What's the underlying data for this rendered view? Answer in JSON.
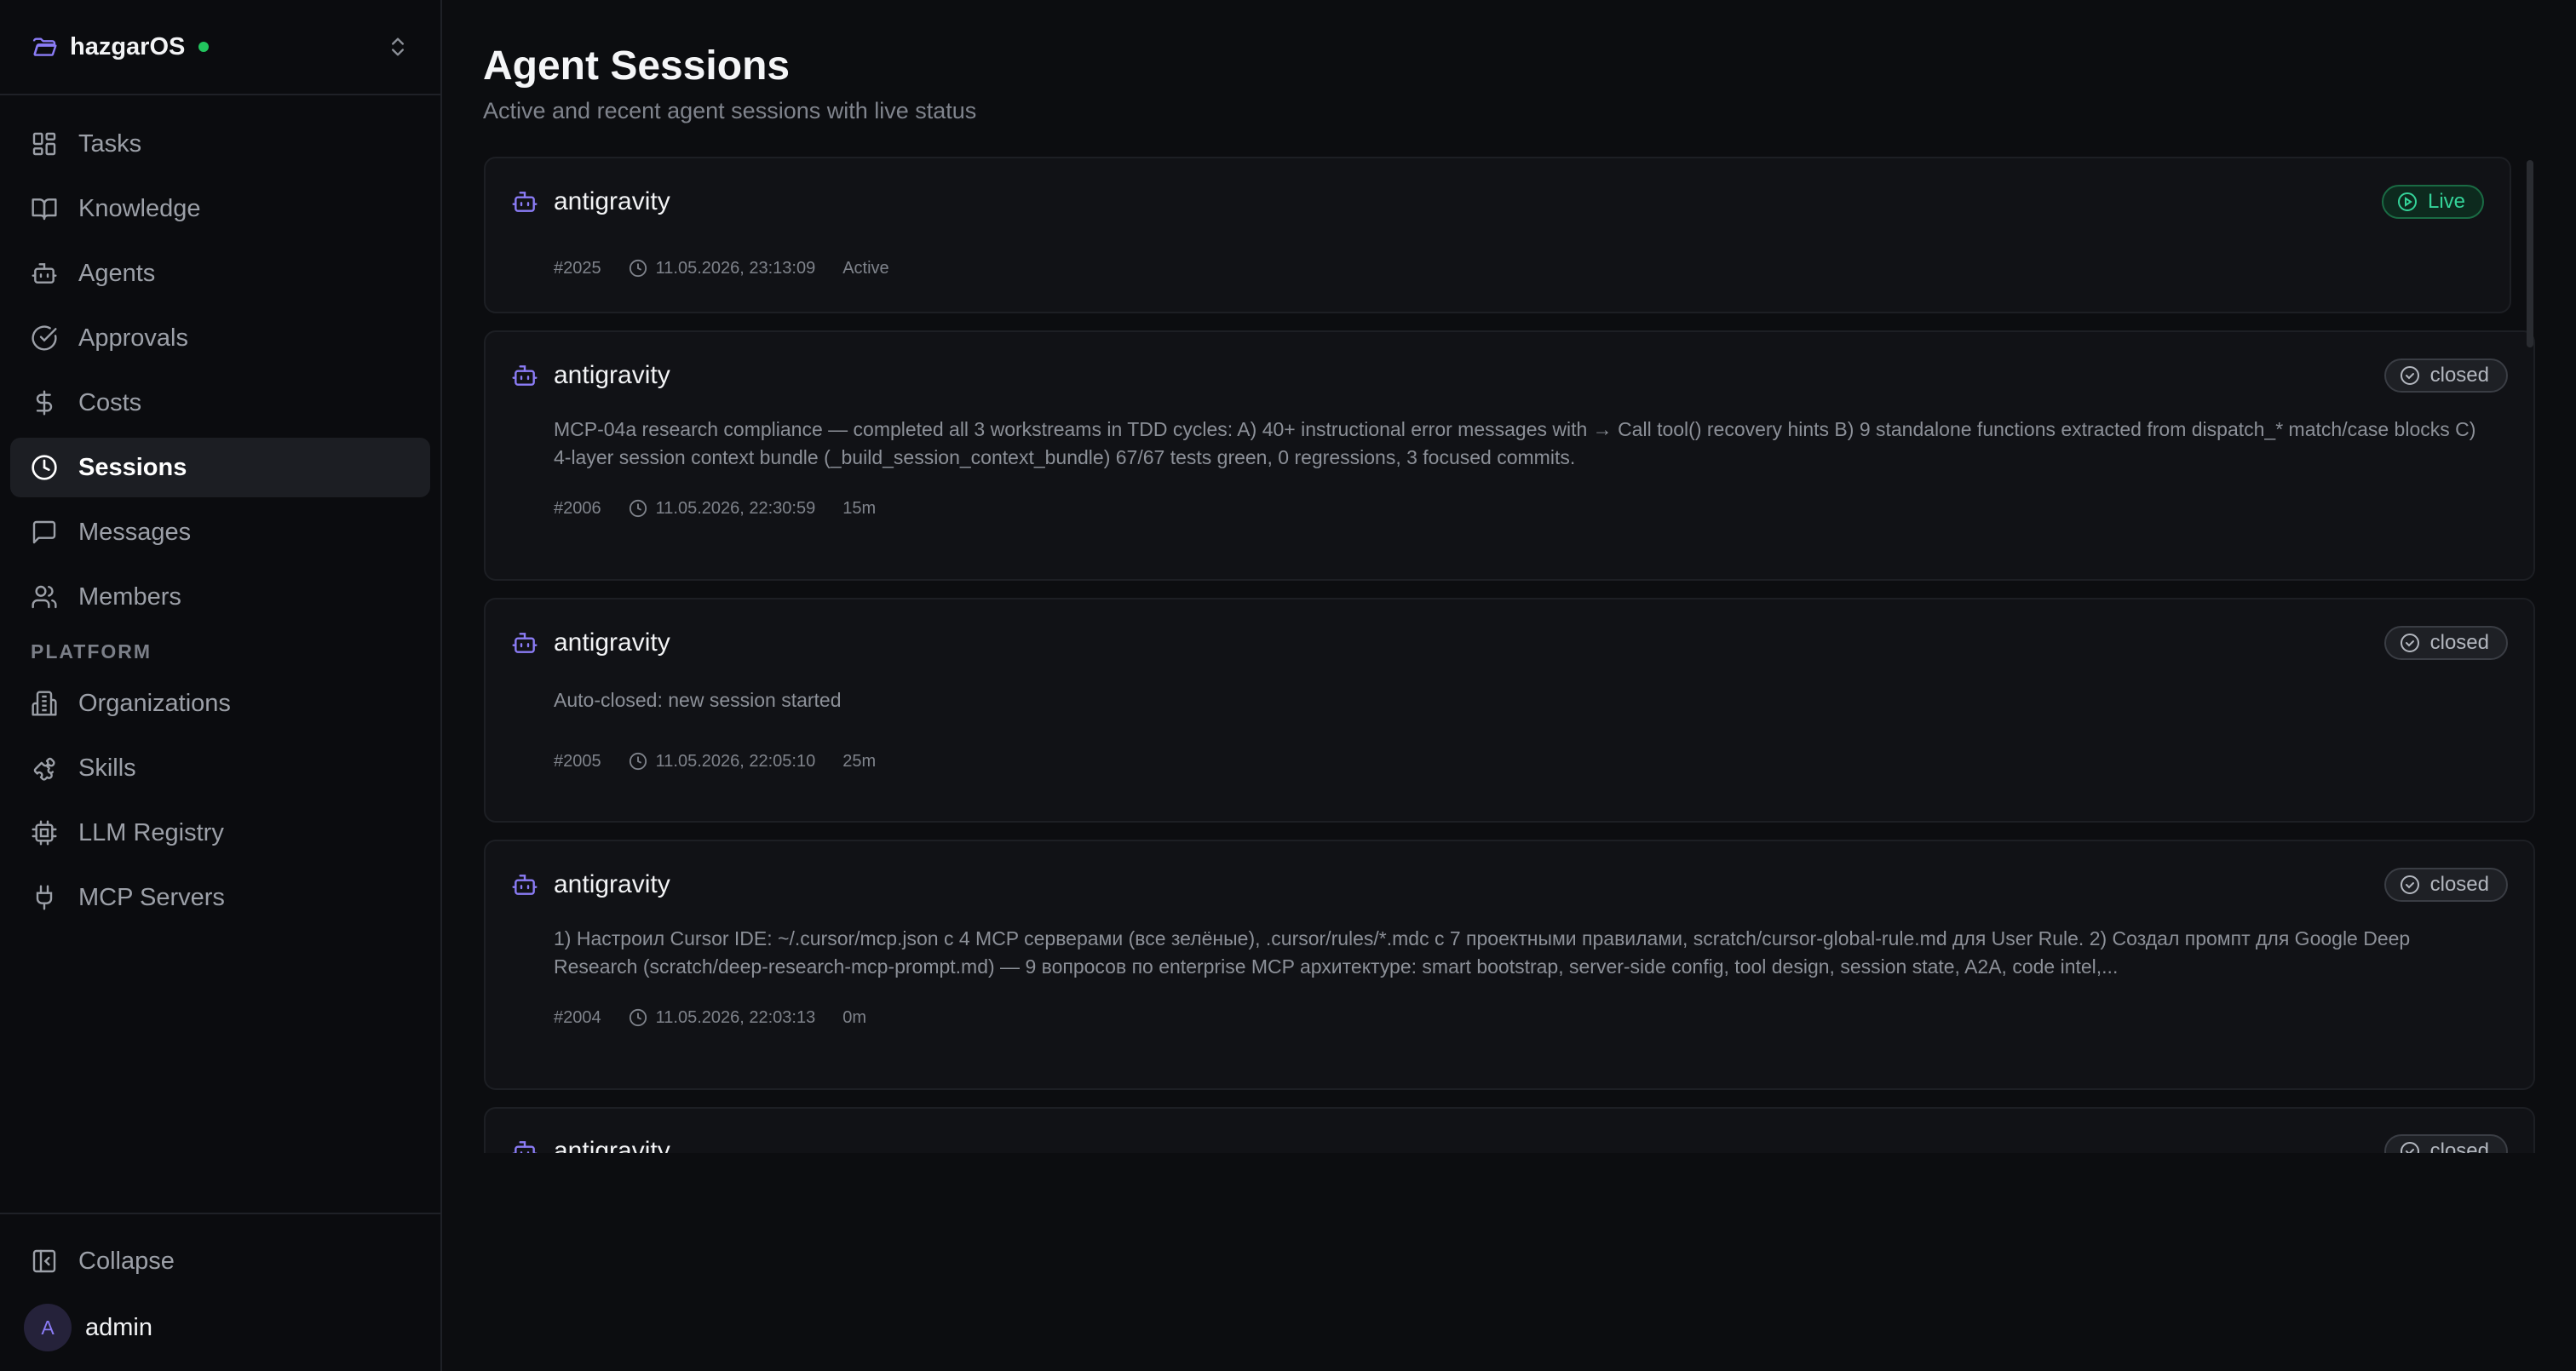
{
  "colors": {
    "accent": "#8b7cf6",
    "live_green": "#34d399",
    "status_dot": "#22c55e"
  },
  "org": {
    "name": "hazgarOS",
    "icon": "folder-icon",
    "switch_icon": "chevrons-up-down-icon"
  },
  "nav": {
    "items": [
      {
        "label": "Tasks",
        "icon": "grid-icon"
      },
      {
        "label": "Knowledge",
        "icon": "book-icon"
      },
      {
        "label": "Agents",
        "icon": "bot-icon"
      },
      {
        "label": "Approvals",
        "icon": "check-circle-icon"
      },
      {
        "label": "Costs",
        "icon": "dollar-icon"
      },
      {
        "label": "Sessions",
        "icon": "clock-icon"
      },
      {
        "label": "Messages",
        "icon": "message-icon"
      },
      {
        "label": "Members",
        "icon": "users-icon"
      }
    ],
    "platform_label": "PLATFORM",
    "platform_items": [
      {
        "label": "Organizations",
        "icon": "building-icon"
      },
      {
        "label": "Skills",
        "icon": "puzzle-icon"
      },
      {
        "label": "LLM Registry",
        "icon": "chip-icon"
      },
      {
        "label": "MCP Servers",
        "icon": "plug-icon"
      }
    ]
  },
  "sidebar_bottom": {
    "collapse_label": "Collapse",
    "avatar_letter": "A",
    "user_name": "admin"
  },
  "page": {
    "title": "Agent Sessions",
    "subtitle": "Active and recent agent sessions with live status"
  },
  "sessions": [
    {
      "agent": "antigravity",
      "status": "Live",
      "description": "",
      "id": "#2025",
      "timestamp": "11.05.2026, 23:13:09",
      "duration": "Active"
    },
    {
      "agent": "antigravity",
      "status": "closed",
      "description": "MCP-04a research compliance — completed all 3 workstreams in TDD cycles: A) 40+ instructional error messages with → Call tool() recovery hints B) 9 standalone functions extracted from dispatch_* match/case blocks C) 4-layer session context bundle (_build_session_context_bundle) 67/67 tests green, 0 regressions, 3 focused commits.",
      "id": "#2006",
      "timestamp": "11.05.2026, 22:30:59",
      "duration": "15m"
    },
    {
      "agent": "antigravity",
      "status": "closed",
      "description": "Auto-closed: new session started",
      "id": "#2005",
      "timestamp": "11.05.2026, 22:05:10",
      "duration": "25m"
    },
    {
      "agent": "antigravity",
      "status": "closed",
      "description": "1) Настроил Cursor IDE: ~/.cursor/mcp.json с 4 MCP серверами (все зелёные), .cursor/rules/*.mdc с 7 проектными правилами, scratch/cursor-global-rule.md для User Rule. 2) Создал промпт для Google Deep Research (scratch/deep-research-mcp-prompt.md) — 9 вопросов по enterprise MCP архитектуре: smart bootstrap, server-side config, tool design, session state, A2A, code intel,...",
      "id": "#2004",
      "timestamp": "11.05.2026, 22:03:13",
      "duration": "0m"
    },
    {
      "agent": "antigravity",
      "status": "closed",
      "description": "",
      "id": "",
      "timestamp": "",
      "duration": ""
    }
  ]
}
